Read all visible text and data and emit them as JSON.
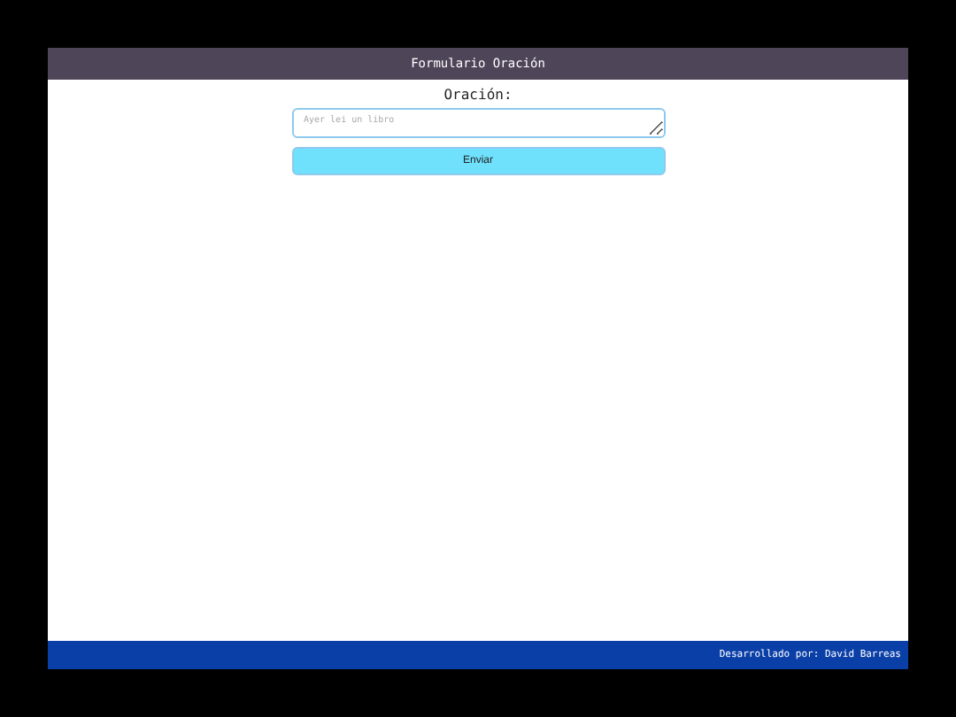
{
  "header": {
    "title": "Formulario Oración"
  },
  "form": {
    "label": "Oración:",
    "placeholder": "Ayer lei un libro",
    "submit": "Enviar"
  },
  "footer": {
    "text": "Desarrollado por: David Barreas"
  }
}
